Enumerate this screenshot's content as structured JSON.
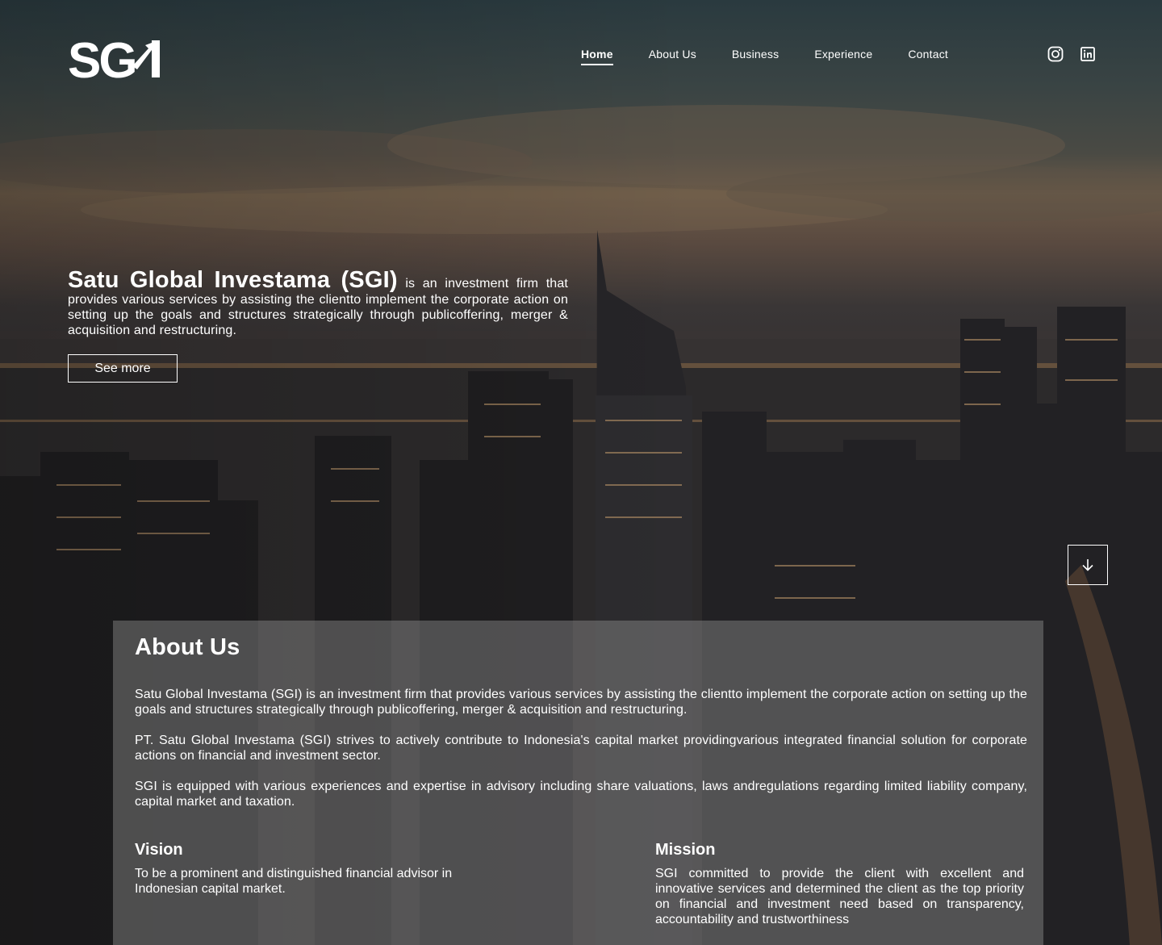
{
  "brand": {
    "logo_text": "SGI"
  },
  "nav": {
    "items": [
      {
        "label": "Home",
        "active": true
      },
      {
        "label": "About Us",
        "active": false
      },
      {
        "label": "Business",
        "active": false
      },
      {
        "label": "Experience",
        "active": false
      },
      {
        "label": "Contact",
        "active": false
      }
    ]
  },
  "social": {
    "icons": [
      "instagram-icon",
      "linkedin-icon"
    ]
  },
  "hero": {
    "title": "Satu Global Investama (SGI)",
    "description": " is an investment firm that provides various services by assisting the clientto implement the corporate action on setting up the goals and structures strategically through publicoffering, merger & acquisition and restructuring.",
    "cta_label": "See more",
    "scroll_icon": "arrow-down-icon"
  },
  "about": {
    "heading": "About Us",
    "paragraphs": [
      "Satu Global Investama (SGI) is an investment firm that provides various services by assisting the clientto implement the corporate action on setting up the goals and structures strategically through publicoffering, merger & acquisition and restructuring.",
      "PT. Satu Global Investama (SGI) strives to actively contribute to Indonesia's capital market providingvarious integrated financial solution for corporate actions on financial and investment sector.",
      "SGI is equipped with various experiences and expertise in advisory including share valuations, laws andregulations regarding limited liability company, capital market and taxation."
    ],
    "vision": {
      "heading": "Vision",
      "text": "To be a prominent and distinguished financial advisor in Indonesian capital market."
    },
    "mission": {
      "heading": "Mission",
      "text": "SGI committed to provide the client with excellent and innovative services and determined the client as the top priority on financial and investment need based on transparency, accountability and trustworthiness"
    }
  },
  "colors": {
    "text": "#ffffff",
    "card_overlay": "rgba(150,150,150,0.42)"
  }
}
